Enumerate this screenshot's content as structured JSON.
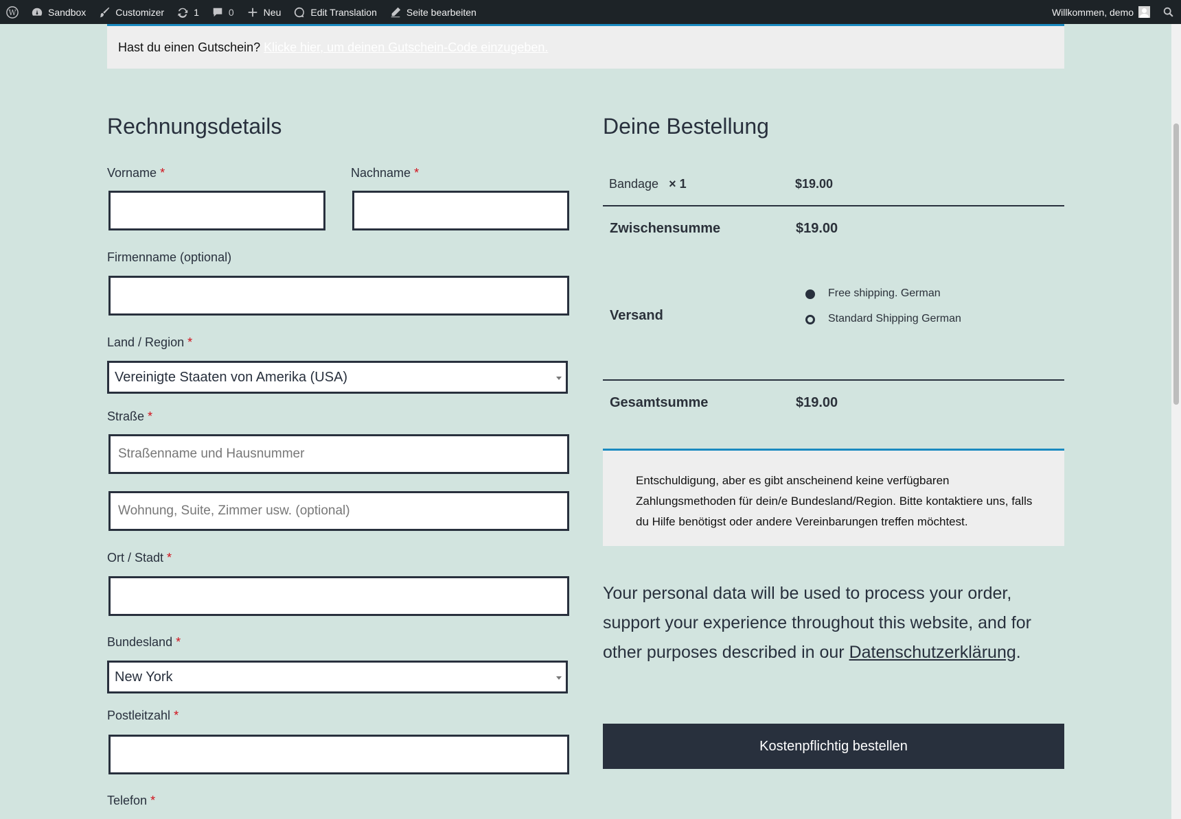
{
  "adminbar": {
    "site": "Sandbox",
    "customizer": "Customizer",
    "updates_count": "1",
    "comments_count": "0",
    "new": "Neu",
    "edit_translation": "Edit Translation",
    "edit_page": "Seite bearbeiten",
    "welcome": "Willkommen, demo"
  },
  "coupon": {
    "text": "Hast du einen Gutschein?",
    "link": "Klicke hier, um deinen Gutschein-Code einzugeben."
  },
  "billing": {
    "title": "Rechnungsdetails",
    "required_mark": "*",
    "first_name_label": "Vorname",
    "last_name_label": "Nachname",
    "company_label": "Firmenname (optional)",
    "country_label": "Land / Region",
    "country_value": "Vereinigte Staaten von Amerika (USA)",
    "street_label": "Straße",
    "street_placeholder": "Straßenname und Hausnummer",
    "street2_placeholder": "Wohnung, Suite, Zimmer usw. (optional)",
    "city_label": "Ort / Stadt",
    "state_label": "Bundesland",
    "state_value": "New York",
    "zip_label": "Postleitzahl",
    "phone_label": "Telefon"
  },
  "order": {
    "title": "Deine Bestellung",
    "item_name": "Bandage",
    "item_qty": "× 1",
    "item_price": "$19.00",
    "subtotal_label": "Zwischensumme",
    "subtotal_value": "$19.00",
    "shipping_label": "Versand",
    "shipping_options": [
      "Free shipping. German",
      "Standard Shipping German"
    ],
    "total_label": "Gesamtsumme",
    "total_value": "$19.00",
    "payment_notice": "Entschuldigung, aber es gibt anscheinend keine verfügbaren Zahlungsmethoden für dein/e Bundesland/Region. Bitte kontaktiere uns, falls du Hilfe benötigst oder andere Vereinbarungen treffen möchtest.",
    "privacy_text": "Your personal data will be used to process your order, support your experience throughout this website, and for other purposes described in our",
    "privacy_link": "Datenschutzerklärung",
    "privacy_end": ".",
    "place_order": "Kostenpflichtig bestellen"
  },
  "colors": {
    "page_bg": "#d2e4df",
    "admin_bg": "#1d2327",
    "accent": "#1a8ac0",
    "dark": "#28303d",
    "required": "#d1111b"
  }
}
